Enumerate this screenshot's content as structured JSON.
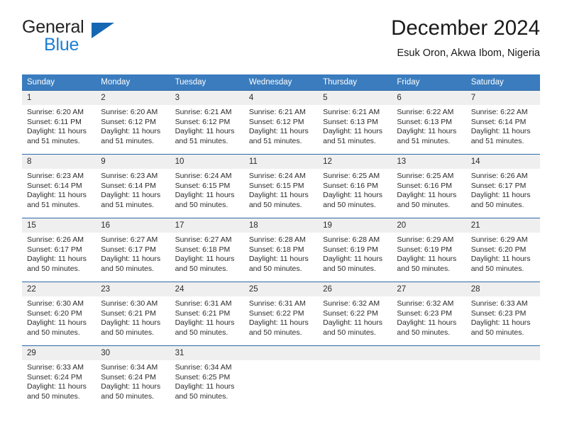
{
  "brand": {
    "line1": "General",
    "line2": "Blue",
    "logo_icon": "blue-triangle-icon"
  },
  "header": {
    "title": "December 2024",
    "subtitle": "Esuk Oron, Akwa Ibom, Nigeria"
  },
  "colors": {
    "header_row_bg": "#3a7cbe",
    "day_number_bg": "#efefef",
    "grid_line": "#2c6aa8",
    "brand_blue": "#1b7fd4",
    "text": "#2b2b2b"
  },
  "calendar": {
    "weekday_headers": [
      "Sunday",
      "Monday",
      "Tuesday",
      "Wednesday",
      "Thursday",
      "Friday",
      "Saturday"
    ],
    "labels": {
      "sunrise": "Sunrise:",
      "sunset": "Sunset:",
      "daylight": "Daylight:"
    },
    "weeks": [
      [
        {
          "day": "1",
          "sunrise": "Sunrise: 6:20 AM",
          "sunset": "Sunset: 6:11 PM",
          "daylight1": "Daylight: 11 hours",
          "daylight2": "and 51 minutes."
        },
        {
          "day": "2",
          "sunrise": "Sunrise: 6:20 AM",
          "sunset": "Sunset: 6:12 PM",
          "daylight1": "Daylight: 11 hours",
          "daylight2": "and 51 minutes."
        },
        {
          "day": "3",
          "sunrise": "Sunrise: 6:21 AM",
          "sunset": "Sunset: 6:12 PM",
          "daylight1": "Daylight: 11 hours",
          "daylight2": "and 51 minutes."
        },
        {
          "day": "4",
          "sunrise": "Sunrise: 6:21 AM",
          "sunset": "Sunset: 6:12 PM",
          "daylight1": "Daylight: 11 hours",
          "daylight2": "and 51 minutes."
        },
        {
          "day": "5",
          "sunrise": "Sunrise: 6:21 AM",
          "sunset": "Sunset: 6:13 PM",
          "daylight1": "Daylight: 11 hours",
          "daylight2": "and 51 minutes."
        },
        {
          "day": "6",
          "sunrise": "Sunrise: 6:22 AM",
          "sunset": "Sunset: 6:13 PM",
          "daylight1": "Daylight: 11 hours",
          "daylight2": "and 51 minutes."
        },
        {
          "day": "7",
          "sunrise": "Sunrise: 6:22 AM",
          "sunset": "Sunset: 6:14 PM",
          "daylight1": "Daylight: 11 hours",
          "daylight2": "and 51 minutes."
        }
      ],
      [
        {
          "day": "8",
          "sunrise": "Sunrise: 6:23 AM",
          "sunset": "Sunset: 6:14 PM",
          "daylight1": "Daylight: 11 hours",
          "daylight2": "and 51 minutes."
        },
        {
          "day": "9",
          "sunrise": "Sunrise: 6:23 AM",
          "sunset": "Sunset: 6:14 PM",
          "daylight1": "Daylight: 11 hours",
          "daylight2": "and 51 minutes."
        },
        {
          "day": "10",
          "sunrise": "Sunrise: 6:24 AM",
          "sunset": "Sunset: 6:15 PM",
          "daylight1": "Daylight: 11 hours",
          "daylight2": "and 50 minutes."
        },
        {
          "day": "11",
          "sunrise": "Sunrise: 6:24 AM",
          "sunset": "Sunset: 6:15 PM",
          "daylight1": "Daylight: 11 hours",
          "daylight2": "and 50 minutes."
        },
        {
          "day": "12",
          "sunrise": "Sunrise: 6:25 AM",
          "sunset": "Sunset: 6:16 PM",
          "daylight1": "Daylight: 11 hours",
          "daylight2": "and 50 minutes."
        },
        {
          "day": "13",
          "sunrise": "Sunrise: 6:25 AM",
          "sunset": "Sunset: 6:16 PM",
          "daylight1": "Daylight: 11 hours",
          "daylight2": "and 50 minutes."
        },
        {
          "day": "14",
          "sunrise": "Sunrise: 6:26 AM",
          "sunset": "Sunset: 6:17 PM",
          "daylight1": "Daylight: 11 hours",
          "daylight2": "and 50 minutes."
        }
      ],
      [
        {
          "day": "15",
          "sunrise": "Sunrise: 6:26 AM",
          "sunset": "Sunset: 6:17 PM",
          "daylight1": "Daylight: 11 hours",
          "daylight2": "and 50 minutes."
        },
        {
          "day": "16",
          "sunrise": "Sunrise: 6:27 AM",
          "sunset": "Sunset: 6:17 PM",
          "daylight1": "Daylight: 11 hours",
          "daylight2": "and 50 minutes."
        },
        {
          "day": "17",
          "sunrise": "Sunrise: 6:27 AM",
          "sunset": "Sunset: 6:18 PM",
          "daylight1": "Daylight: 11 hours",
          "daylight2": "and 50 minutes."
        },
        {
          "day": "18",
          "sunrise": "Sunrise: 6:28 AM",
          "sunset": "Sunset: 6:18 PM",
          "daylight1": "Daylight: 11 hours",
          "daylight2": "and 50 minutes."
        },
        {
          "day": "19",
          "sunrise": "Sunrise: 6:28 AM",
          "sunset": "Sunset: 6:19 PM",
          "daylight1": "Daylight: 11 hours",
          "daylight2": "and 50 minutes."
        },
        {
          "day": "20",
          "sunrise": "Sunrise: 6:29 AM",
          "sunset": "Sunset: 6:19 PM",
          "daylight1": "Daylight: 11 hours",
          "daylight2": "and 50 minutes."
        },
        {
          "day": "21",
          "sunrise": "Sunrise: 6:29 AM",
          "sunset": "Sunset: 6:20 PM",
          "daylight1": "Daylight: 11 hours",
          "daylight2": "and 50 minutes."
        }
      ],
      [
        {
          "day": "22",
          "sunrise": "Sunrise: 6:30 AM",
          "sunset": "Sunset: 6:20 PM",
          "daylight1": "Daylight: 11 hours",
          "daylight2": "and 50 minutes."
        },
        {
          "day": "23",
          "sunrise": "Sunrise: 6:30 AM",
          "sunset": "Sunset: 6:21 PM",
          "daylight1": "Daylight: 11 hours",
          "daylight2": "and 50 minutes."
        },
        {
          "day": "24",
          "sunrise": "Sunrise: 6:31 AM",
          "sunset": "Sunset: 6:21 PM",
          "daylight1": "Daylight: 11 hours",
          "daylight2": "and 50 minutes."
        },
        {
          "day": "25",
          "sunrise": "Sunrise: 6:31 AM",
          "sunset": "Sunset: 6:22 PM",
          "daylight1": "Daylight: 11 hours",
          "daylight2": "and 50 minutes."
        },
        {
          "day": "26",
          "sunrise": "Sunrise: 6:32 AM",
          "sunset": "Sunset: 6:22 PM",
          "daylight1": "Daylight: 11 hours",
          "daylight2": "and 50 minutes."
        },
        {
          "day": "27",
          "sunrise": "Sunrise: 6:32 AM",
          "sunset": "Sunset: 6:23 PM",
          "daylight1": "Daylight: 11 hours",
          "daylight2": "and 50 minutes."
        },
        {
          "day": "28",
          "sunrise": "Sunrise: 6:33 AM",
          "sunset": "Sunset: 6:23 PM",
          "daylight1": "Daylight: 11 hours",
          "daylight2": "and 50 minutes."
        }
      ],
      [
        {
          "day": "29",
          "sunrise": "Sunrise: 6:33 AM",
          "sunset": "Sunset: 6:24 PM",
          "daylight1": "Daylight: 11 hours",
          "daylight2": "and 50 minutes."
        },
        {
          "day": "30",
          "sunrise": "Sunrise: 6:34 AM",
          "sunset": "Sunset: 6:24 PM",
          "daylight1": "Daylight: 11 hours",
          "daylight2": "and 50 minutes."
        },
        {
          "day": "31",
          "sunrise": "Sunrise: 6:34 AM",
          "sunset": "Sunset: 6:25 PM",
          "daylight1": "Daylight: 11 hours",
          "daylight2": "and 50 minutes."
        },
        {
          "day": "",
          "sunrise": "",
          "sunset": "",
          "daylight1": "",
          "daylight2": ""
        },
        {
          "day": "",
          "sunrise": "",
          "sunset": "",
          "daylight1": "",
          "daylight2": ""
        },
        {
          "day": "",
          "sunrise": "",
          "sunset": "",
          "daylight1": "",
          "daylight2": ""
        },
        {
          "day": "",
          "sunrise": "",
          "sunset": "",
          "daylight1": "",
          "daylight2": ""
        }
      ]
    ]
  }
}
